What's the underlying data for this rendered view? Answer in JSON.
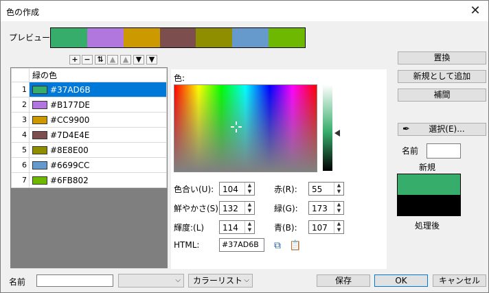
{
  "window": {
    "title": "色の作成",
    "close_glyph": "✕"
  },
  "preview": {
    "label": "プレビュー",
    "colors": [
      "#37AD6B",
      "#B177DE",
      "#CC9900",
      "#7D4E4E",
      "#8E8E00",
      "#6699CC",
      "#6FB802"
    ]
  },
  "toolbar": {
    "add": "+",
    "remove": "−",
    "swap": "⇅",
    "top": "▲",
    "up": "▲",
    "down": "▼",
    "bottom": "▼"
  },
  "list": {
    "header": "緑の色",
    "rows": [
      {
        "num": "1",
        "hex": "#37AD6B",
        "color": "#37AD6B"
      },
      {
        "num": "2",
        "hex": "#B177DE",
        "color": "#B177DE"
      },
      {
        "num": "3",
        "hex": "#CC9900",
        "color": "#CC9900"
      },
      {
        "num": "4",
        "hex": "#7D4E4E",
        "color": "#7D4E4E"
      },
      {
        "num": "5",
        "hex": "#8E8E00",
        "color": "#8E8E00"
      },
      {
        "num": "6",
        "hex": "#6699CC",
        "color": "#6699CC"
      },
      {
        "num": "7",
        "hex": "#6FB802",
        "color": "#6FB802"
      }
    ]
  },
  "picker": {
    "label": "色:",
    "hue_label": "色合い(U):",
    "hue": "104",
    "sat_label": "鮮やかさ(S):",
    "sat": "132",
    "lum_label": "輝度:(L)",
    "lum": "114",
    "red_label": "赤(R):",
    "red": "55",
    "green_label": "緑(G):",
    "green": "173",
    "blue_label": "青(B):",
    "blue": "107",
    "html_label": "HTML:",
    "html": "#37AD6B"
  },
  "right": {
    "replace": "置換",
    "add_new": "新規として追加",
    "interpolate": "補間",
    "select": "選択(E)...",
    "name_label": "名前",
    "new_label": "新規",
    "after_label": "処理後",
    "new_color": "#37AD6B",
    "after_color": "#000000"
  },
  "footer": {
    "name_label": "名前",
    "name_value": "",
    "combo1": "",
    "combo2": "カラーリスト",
    "save": "保存",
    "ok": "OK",
    "cancel": "キャンセル"
  }
}
